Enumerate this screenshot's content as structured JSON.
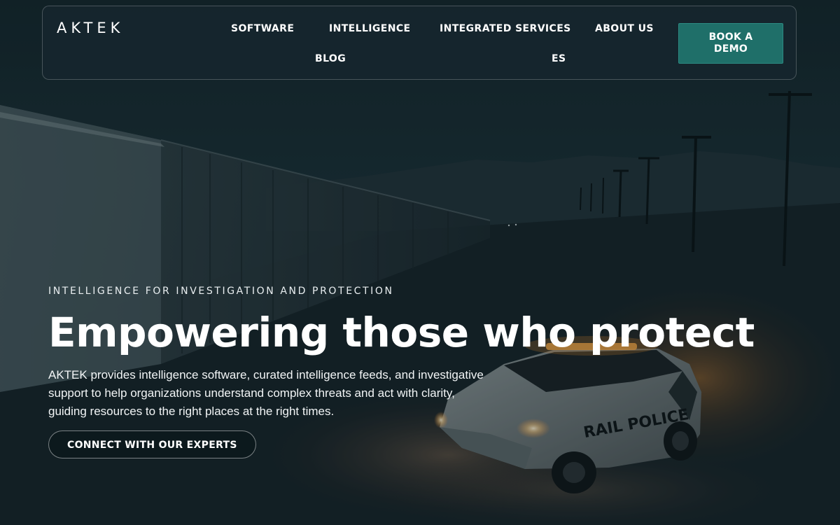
{
  "brand": {
    "logo_text": "AKTEK",
    "accent_color": "#1f6f69"
  },
  "nav": {
    "items": [
      {
        "label": "SOFTWARE"
      },
      {
        "label": "INTELLIGENCE"
      },
      {
        "label": "INTEGRATED SERVICES"
      },
      {
        "label": "ABOUT US"
      },
      {
        "label": "BLOG"
      },
      {
        "label": "ES"
      }
    ],
    "demo_button_label": "BOOK A DEMO"
  },
  "hero": {
    "eyebrow": "INTELLIGENCE FOR INVESTIGATION AND PROTECTION",
    "headline": "Empowering those who protect",
    "description": "AKTEK provides intelligence software, curated intelligence feeds, and investigative support to help organizations understand complex threats and act with clarity, guiding resources to the right places at the right times.",
    "cta_label": "CONNECT WITH OUR EXPERTS",
    "background_image": "rail-police-vehicle-night",
    "vehicle_text": "RAIL POLICE"
  }
}
